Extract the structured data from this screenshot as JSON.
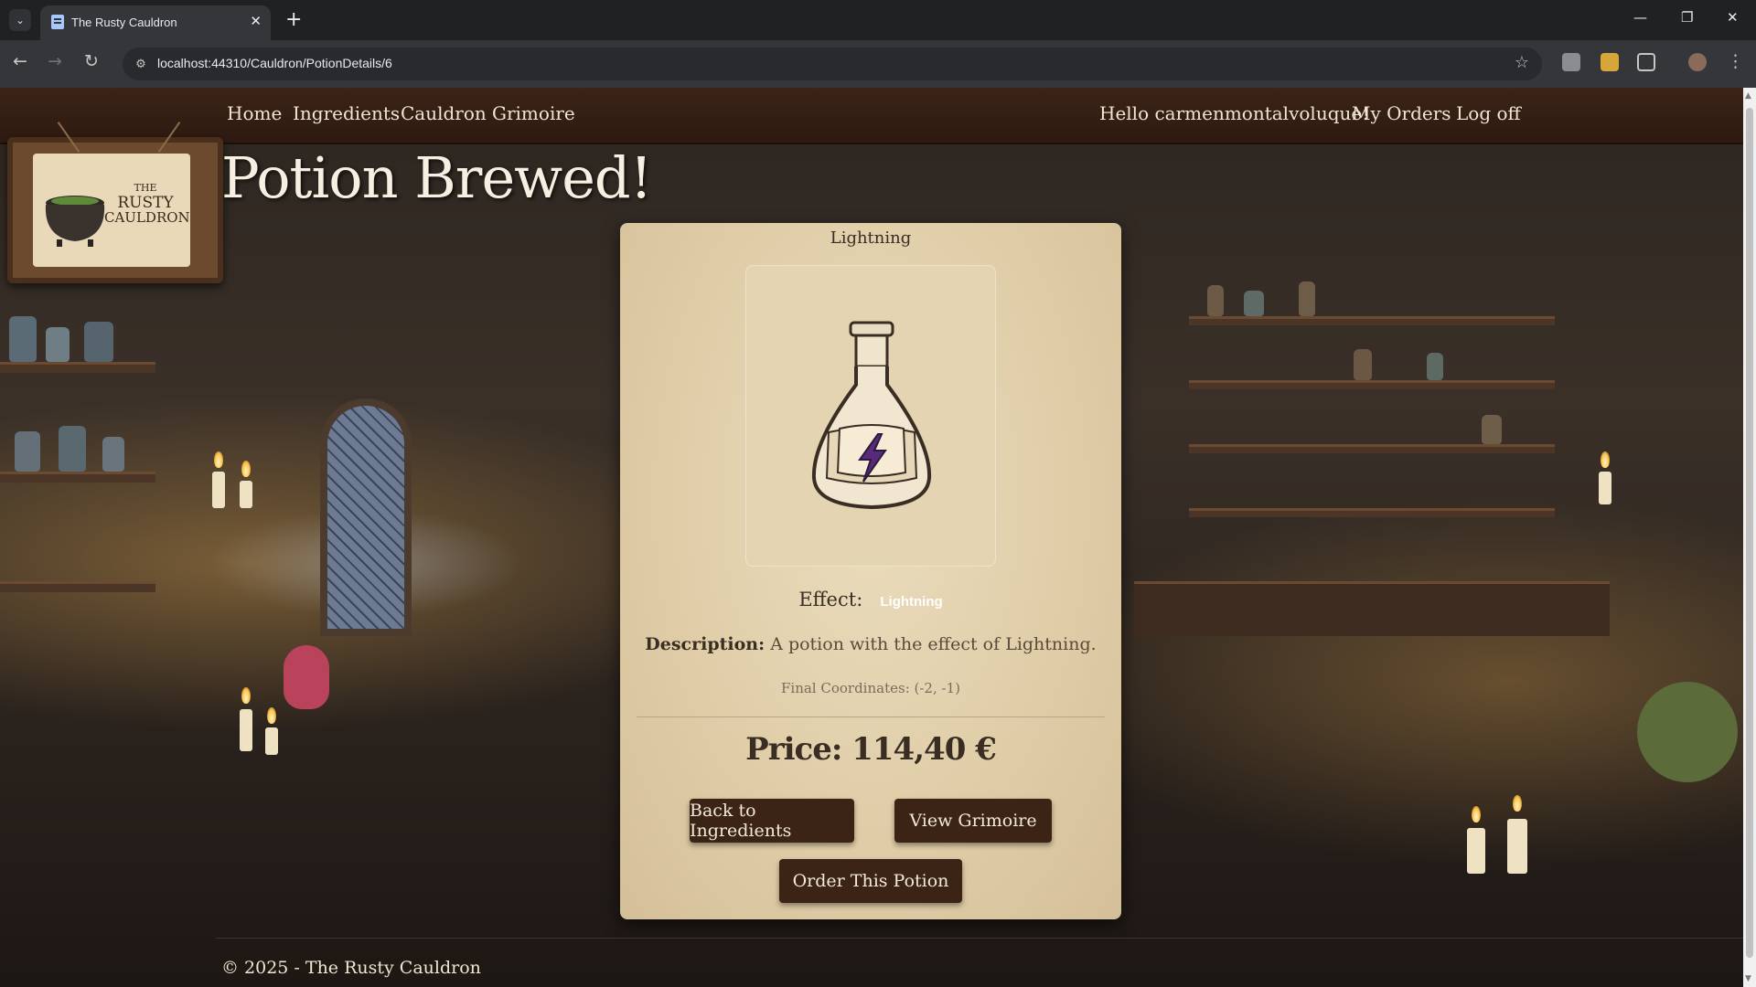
{
  "browser": {
    "tab_title": "The Rusty Cauldron",
    "url": "localhost:44310/Cauldron/PotionDetails/6"
  },
  "nav": {
    "home": "Home",
    "ingredients": "Ingredients",
    "cauldron": "Cauldron",
    "grimoire": "Grimoire",
    "greeting": "Hello carmenmontalvoluque!",
    "my_orders": "My Orders",
    "log_off": "Log off"
  },
  "logo": {
    "line1": "THE",
    "line2": "RUSTY",
    "line3": "CAULDRON"
  },
  "page_title": "Potion Brewed!",
  "potion": {
    "name": "Lightning",
    "effect_label": "Effect:",
    "effect_value": "Lightning",
    "description_label": "Description:",
    "description": "A potion with the effect of Lightning.",
    "coordinates": "Final Coordinates: (-2, -1)",
    "price": "Price: 114,40 €",
    "effect_icon": "lightning-bolt-icon"
  },
  "buttons": {
    "back": "Back to Ingredients",
    "grimoire": "View Grimoire",
    "order": "Order This Potion"
  },
  "footer": "© 2025 - The Rusty Cauldron",
  "colors": {
    "navbar": "#3b2418",
    "button": "#3b2416",
    "card": "#e4d4b2",
    "bolt": "#5a2a7a"
  }
}
